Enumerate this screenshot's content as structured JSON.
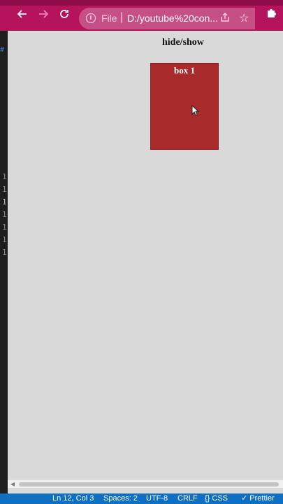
{
  "editor": {
    "gutter_mark": "#",
    "gutter_lines": [
      "1",
      "1",
      "1",
      "1",
      "1",
      "1",
      "1"
    ],
    "active_line_index": 2
  },
  "browser": {
    "url_scheme": "File",
    "url_separator": "|",
    "url": "D:/youtube%20con...",
    "toolbar_color": "#b5135c"
  },
  "page": {
    "heading": "hide/show",
    "box_label": "box 1",
    "box_color": "#a82a2a"
  },
  "statusbar": {
    "position": "Ln 12, Col 3",
    "spaces": "Spaces: 2",
    "encoding": "UTF-8",
    "eol": "CRLF",
    "language": "{} CSS",
    "formatter": "✓ Prettier",
    "color": "#0f6fc3"
  }
}
